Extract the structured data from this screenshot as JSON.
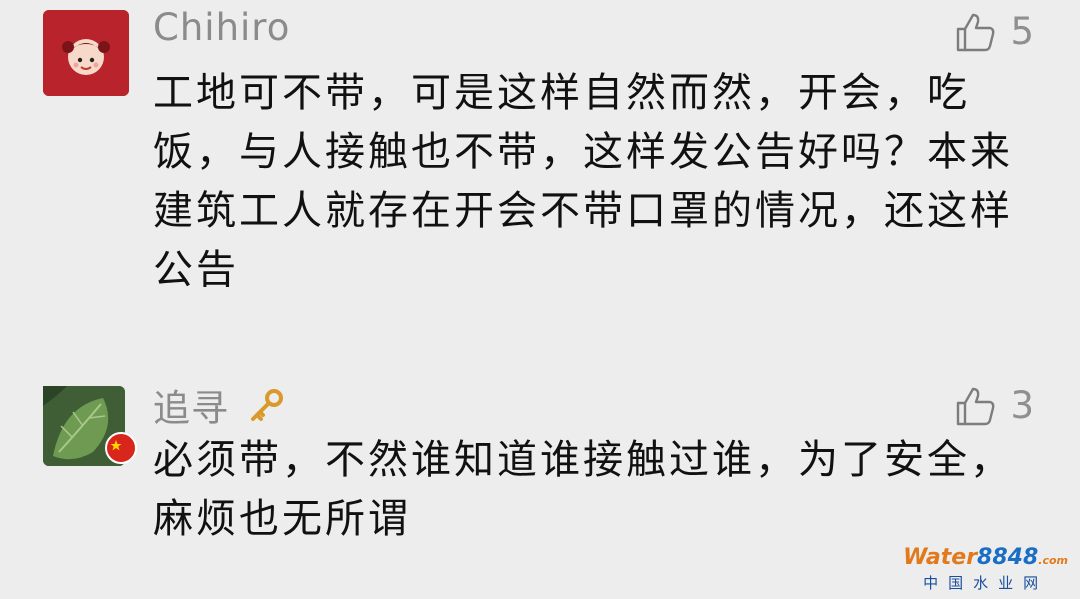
{
  "comments": [
    {
      "username": "Chihiro",
      "likes": "5",
      "text": "工地可不带，可是这样自然而然，开会，吃饭，与人接触也不带，这样发公告好吗？本来建筑工人就存在开会不带口罩的情况，还这样公告",
      "avatar_icon": "cartoon-girl-avatar",
      "avatar_color": "#b8232c"
    },
    {
      "username": "追寻",
      "username_icon": "key-icon",
      "likes": "3",
      "text": "必须带，不然谁知道谁接触过谁，为了安全，麻烦也无所谓",
      "avatar_icon": "leaf-photo-avatar",
      "avatar_color": "#3f5e36"
    }
  ],
  "watermark": {
    "brand_a": "Water",
    "brand_b": "8848",
    "brand_c": ".com",
    "tagline": "中国水业网"
  }
}
